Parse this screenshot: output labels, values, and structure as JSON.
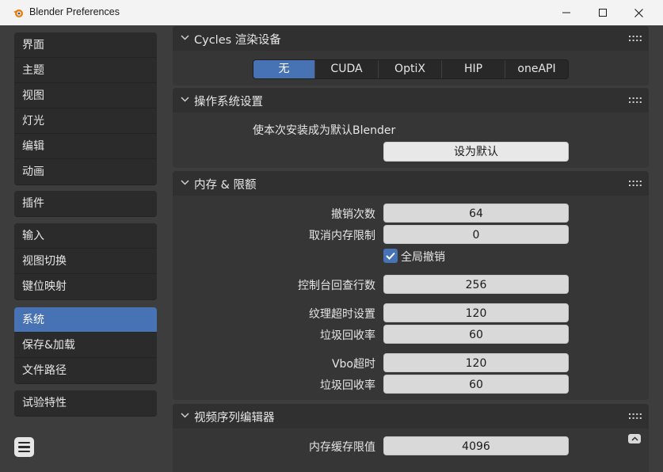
{
  "window": {
    "title": "Blender Preferences",
    "app_icon": "blender-logo-icon",
    "controls": [
      "minimize-icon",
      "maximize-icon",
      "close-icon"
    ]
  },
  "sidebar": {
    "groups": [
      [
        "界面",
        "主题",
        "视图",
        "灯光",
        "编辑",
        "动画"
      ],
      [
        "插件"
      ],
      [
        "输入",
        "视图切换",
        "键位映射"
      ],
      [
        "系统",
        "保存&加载",
        "文件路径"
      ],
      [
        "试验特性"
      ]
    ],
    "active": "系统",
    "menu_icon": "hamburger-menu-icon"
  },
  "cycles": {
    "title": "Cycles 渲染设备",
    "options": [
      "无",
      "CUDA",
      "OptiX",
      "HIP",
      "oneAPI"
    ],
    "selected": "无"
  },
  "os": {
    "title": "操作系统设置",
    "label": "使本次安装成为默认Blender",
    "button": "设为默认"
  },
  "memory": {
    "title": "内存 & 限额",
    "undo_steps_label": "撤销次数",
    "undo_steps": "64",
    "undo_mem_label": "取消内存限制",
    "undo_mem": "0",
    "global_undo_label": "全局撤销",
    "global_undo": true,
    "console_label": "控制台回查行数",
    "console": "256",
    "tex_timeout_label": "纹理超时设置",
    "tex_timeout": "120",
    "tex_gc_label": "垃圾回收率",
    "tex_gc": "60",
    "vbo_timeout_label": "Vbo超时",
    "vbo_timeout": "120",
    "vbo_gc_label": "垃圾回收率",
    "vbo_gc": "60"
  },
  "sequencer": {
    "title": "视频序列编辑器",
    "cache_label": "内存缓存限值",
    "cache": "4096"
  },
  "colors": {
    "accent": "#4772b3",
    "panel": "#363636",
    "header": "#303030",
    "background": "#3d3d3d"
  }
}
